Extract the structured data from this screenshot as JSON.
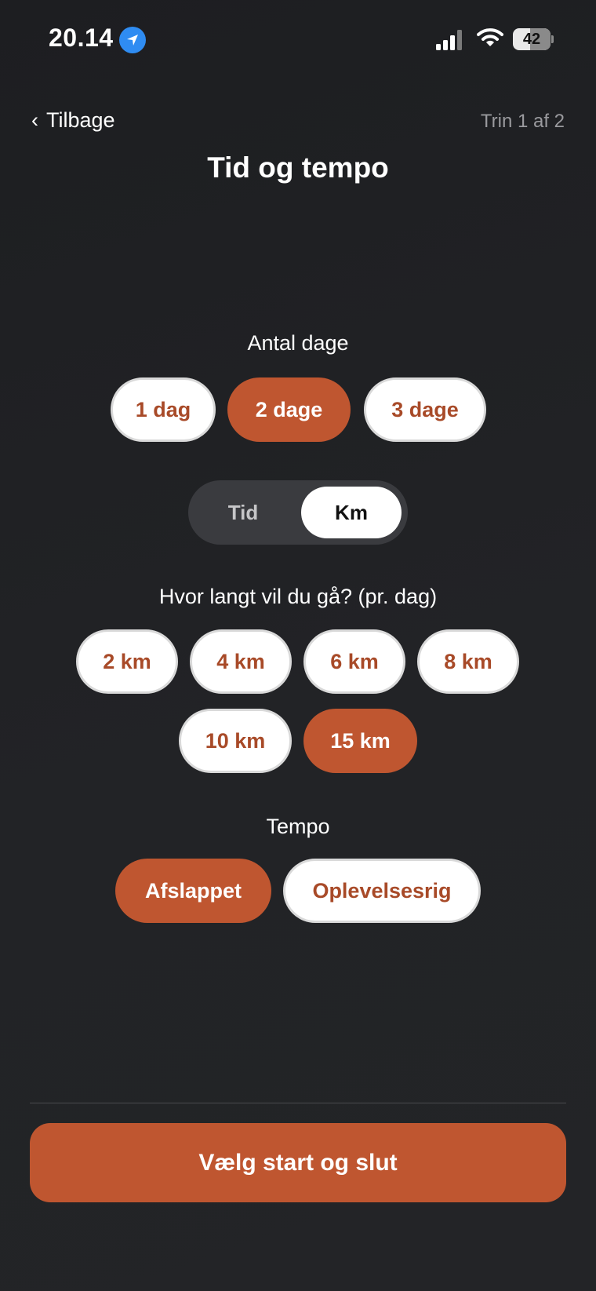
{
  "status_bar": {
    "time": "20.14",
    "location_icon": "location-arrow-icon",
    "signal_icon": "cellular-signal-icon",
    "wifi_icon": "wifi-icon",
    "battery_level": "42"
  },
  "nav": {
    "back_chevron": "‹",
    "back_label": "Tilbage",
    "step_label": "Trin 1 af 2"
  },
  "title": "Tid og tempo",
  "days": {
    "label": "Antal dage",
    "options": [
      "1 dag",
      "2 dage",
      "3 dage"
    ],
    "selected": "2 dage"
  },
  "mode_toggle": {
    "options": [
      "Tid",
      "Km"
    ],
    "selected": "Km"
  },
  "distance": {
    "label": "Hvor langt vil du gå? (pr. dag)",
    "options": [
      "2 km",
      "4 km",
      "6 km",
      "8 km",
      "10 km",
      "15 km"
    ],
    "selected": "15 km"
  },
  "tempo": {
    "label": "Tempo",
    "options": [
      "Afslappet",
      "Oplevelsesrig"
    ],
    "selected": "Afslappet"
  },
  "cta_label": "Vælg start og slut",
  "colors": {
    "accent": "#bf5630",
    "accent_text": "#a84a28",
    "background": "#1f2023",
    "chip_off_bg": "#ffffff",
    "toggle_bg": "#3a3b3f",
    "muted_text": "#9a9a9e"
  }
}
